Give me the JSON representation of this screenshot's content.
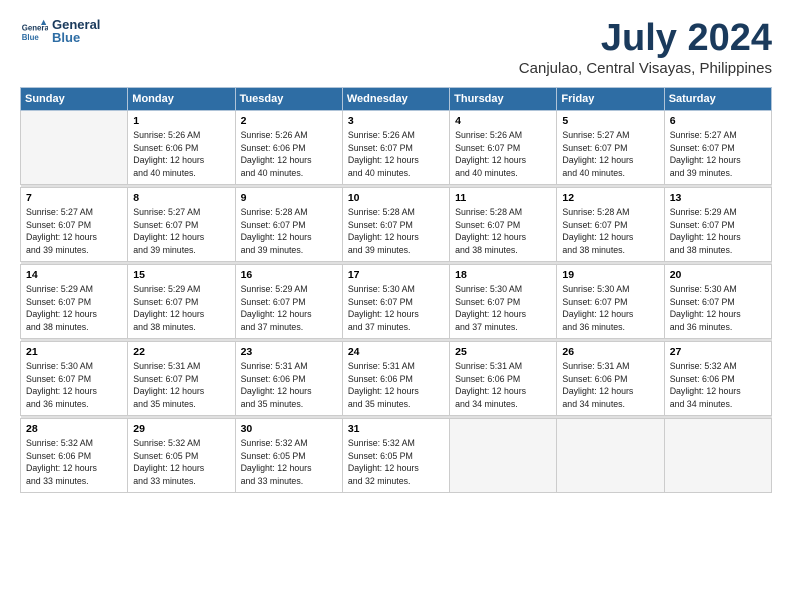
{
  "logo": {
    "line1": "General",
    "line2": "Blue"
  },
  "title": "July 2024",
  "subtitle": "Canjulao, Central Visayas, Philippines",
  "days_header": [
    "Sunday",
    "Monday",
    "Tuesday",
    "Wednesday",
    "Thursday",
    "Friday",
    "Saturday"
  ],
  "weeks": [
    [
      {
        "num": "",
        "lines": []
      },
      {
        "num": "1",
        "lines": [
          "Sunrise: 5:26 AM",
          "Sunset: 6:06 PM",
          "Daylight: 12 hours",
          "and 40 minutes."
        ]
      },
      {
        "num": "2",
        "lines": [
          "Sunrise: 5:26 AM",
          "Sunset: 6:06 PM",
          "Daylight: 12 hours",
          "and 40 minutes."
        ]
      },
      {
        "num": "3",
        "lines": [
          "Sunrise: 5:26 AM",
          "Sunset: 6:07 PM",
          "Daylight: 12 hours",
          "and 40 minutes."
        ]
      },
      {
        "num": "4",
        "lines": [
          "Sunrise: 5:26 AM",
          "Sunset: 6:07 PM",
          "Daylight: 12 hours",
          "and 40 minutes."
        ]
      },
      {
        "num": "5",
        "lines": [
          "Sunrise: 5:27 AM",
          "Sunset: 6:07 PM",
          "Daylight: 12 hours",
          "and 40 minutes."
        ]
      },
      {
        "num": "6",
        "lines": [
          "Sunrise: 5:27 AM",
          "Sunset: 6:07 PM",
          "Daylight: 12 hours",
          "and 39 minutes."
        ]
      }
    ],
    [
      {
        "num": "7",
        "lines": [
          "Sunrise: 5:27 AM",
          "Sunset: 6:07 PM",
          "Daylight: 12 hours",
          "and 39 minutes."
        ]
      },
      {
        "num": "8",
        "lines": [
          "Sunrise: 5:27 AM",
          "Sunset: 6:07 PM",
          "Daylight: 12 hours",
          "and 39 minutes."
        ]
      },
      {
        "num": "9",
        "lines": [
          "Sunrise: 5:28 AM",
          "Sunset: 6:07 PM",
          "Daylight: 12 hours",
          "and 39 minutes."
        ]
      },
      {
        "num": "10",
        "lines": [
          "Sunrise: 5:28 AM",
          "Sunset: 6:07 PM",
          "Daylight: 12 hours",
          "and 39 minutes."
        ]
      },
      {
        "num": "11",
        "lines": [
          "Sunrise: 5:28 AM",
          "Sunset: 6:07 PM",
          "Daylight: 12 hours",
          "and 38 minutes."
        ]
      },
      {
        "num": "12",
        "lines": [
          "Sunrise: 5:28 AM",
          "Sunset: 6:07 PM",
          "Daylight: 12 hours",
          "and 38 minutes."
        ]
      },
      {
        "num": "13",
        "lines": [
          "Sunrise: 5:29 AM",
          "Sunset: 6:07 PM",
          "Daylight: 12 hours",
          "and 38 minutes."
        ]
      }
    ],
    [
      {
        "num": "14",
        "lines": [
          "Sunrise: 5:29 AM",
          "Sunset: 6:07 PM",
          "Daylight: 12 hours",
          "and 38 minutes."
        ]
      },
      {
        "num": "15",
        "lines": [
          "Sunrise: 5:29 AM",
          "Sunset: 6:07 PM",
          "Daylight: 12 hours",
          "and 38 minutes."
        ]
      },
      {
        "num": "16",
        "lines": [
          "Sunrise: 5:29 AM",
          "Sunset: 6:07 PM",
          "Daylight: 12 hours",
          "and 37 minutes."
        ]
      },
      {
        "num": "17",
        "lines": [
          "Sunrise: 5:30 AM",
          "Sunset: 6:07 PM",
          "Daylight: 12 hours",
          "and 37 minutes."
        ]
      },
      {
        "num": "18",
        "lines": [
          "Sunrise: 5:30 AM",
          "Sunset: 6:07 PM",
          "Daylight: 12 hours",
          "and 37 minutes."
        ]
      },
      {
        "num": "19",
        "lines": [
          "Sunrise: 5:30 AM",
          "Sunset: 6:07 PM",
          "Daylight: 12 hours",
          "and 36 minutes."
        ]
      },
      {
        "num": "20",
        "lines": [
          "Sunrise: 5:30 AM",
          "Sunset: 6:07 PM",
          "Daylight: 12 hours",
          "and 36 minutes."
        ]
      }
    ],
    [
      {
        "num": "21",
        "lines": [
          "Sunrise: 5:30 AM",
          "Sunset: 6:07 PM",
          "Daylight: 12 hours",
          "and 36 minutes."
        ]
      },
      {
        "num": "22",
        "lines": [
          "Sunrise: 5:31 AM",
          "Sunset: 6:07 PM",
          "Daylight: 12 hours",
          "and 35 minutes."
        ]
      },
      {
        "num": "23",
        "lines": [
          "Sunrise: 5:31 AM",
          "Sunset: 6:06 PM",
          "Daylight: 12 hours",
          "and 35 minutes."
        ]
      },
      {
        "num": "24",
        "lines": [
          "Sunrise: 5:31 AM",
          "Sunset: 6:06 PM",
          "Daylight: 12 hours",
          "and 35 minutes."
        ]
      },
      {
        "num": "25",
        "lines": [
          "Sunrise: 5:31 AM",
          "Sunset: 6:06 PM",
          "Daylight: 12 hours",
          "and 34 minutes."
        ]
      },
      {
        "num": "26",
        "lines": [
          "Sunrise: 5:31 AM",
          "Sunset: 6:06 PM",
          "Daylight: 12 hours",
          "and 34 minutes."
        ]
      },
      {
        "num": "27",
        "lines": [
          "Sunrise: 5:32 AM",
          "Sunset: 6:06 PM",
          "Daylight: 12 hours",
          "and 34 minutes."
        ]
      }
    ],
    [
      {
        "num": "28",
        "lines": [
          "Sunrise: 5:32 AM",
          "Sunset: 6:06 PM",
          "Daylight: 12 hours",
          "and 33 minutes."
        ]
      },
      {
        "num": "29",
        "lines": [
          "Sunrise: 5:32 AM",
          "Sunset: 6:05 PM",
          "Daylight: 12 hours",
          "and 33 minutes."
        ]
      },
      {
        "num": "30",
        "lines": [
          "Sunrise: 5:32 AM",
          "Sunset: 6:05 PM",
          "Daylight: 12 hours",
          "and 33 minutes."
        ]
      },
      {
        "num": "31",
        "lines": [
          "Sunrise: 5:32 AM",
          "Sunset: 6:05 PM",
          "Daylight: 12 hours",
          "and 32 minutes."
        ]
      },
      {
        "num": "",
        "lines": []
      },
      {
        "num": "",
        "lines": []
      },
      {
        "num": "",
        "lines": []
      }
    ]
  ]
}
